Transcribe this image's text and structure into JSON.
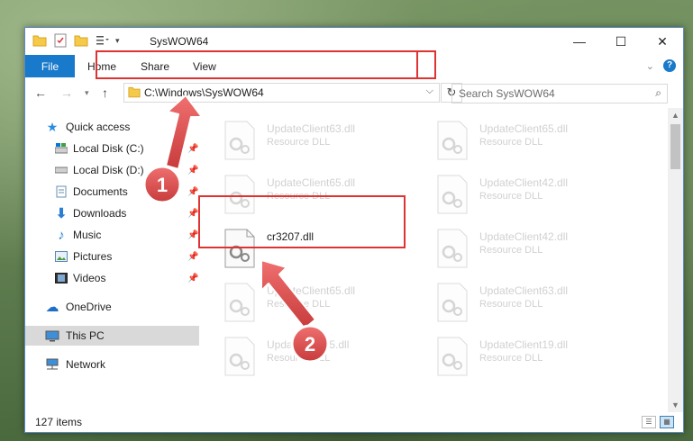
{
  "window": {
    "title": "SysWOW64"
  },
  "ribbon": {
    "tabs": [
      "File",
      "Home",
      "Share",
      "View"
    ]
  },
  "nav": {
    "address": "C:\\Windows\\SysWOW64",
    "search_placeholder": "Search SysWOW64"
  },
  "sidebar": {
    "items": [
      {
        "label": "Quick access",
        "icon": "star-icon"
      },
      {
        "label": "Local Disk (C:)",
        "icon": "drive-icon",
        "pinned": true
      },
      {
        "label": "Local Disk (D:)",
        "icon": "drive-icon",
        "pinned": true
      },
      {
        "label": "Documents",
        "icon": "documents-icon",
        "pinned": true
      },
      {
        "label": "Downloads",
        "icon": "download-icon",
        "pinned": true
      },
      {
        "label": "Music",
        "icon": "music-icon",
        "pinned": true
      },
      {
        "label": "Pictures",
        "icon": "pictures-icon",
        "pinned": true
      },
      {
        "label": "Videos",
        "icon": "videos-icon",
        "pinned": true
      },
      {
        "label": "OneDrive",
        "icon": "cloud-icon"
      },
      {
        "label": "This PC",
        "icon": "computer-icon",
        "selected": true
      },
      {
        "label": "Network",
        "icon": "network-icon"
      }
    ]
  },
  "files": [
    {
      "name": "UpdateClient63.dll",
      "desc": "Resource DLL",
      "faded": true
    },
    {
      "name": "UpdateClient65.dll",
      "desc": "Resource DLL",
      "faded": true
    },
    {
      "name": "UpdateClient65.dll",
      "desc": "Resource DLL",
      "faded": true
    },
    {
      "name": "UpdateClient42.dll",
      "desc": "Resource DLL",
      "faded": true
    },
    {
      "name": "cr3207.dll",
      "desc": "",
      "faded": false
    },
    {
      "name": "UpdateClient42.dll",
      "desc": "Resource DLL",
      "faded": true
    },
    {
      "name": "UpdateClient65.dll",
      "desc": "Resource DLL",
      "faded": true
    },
    {
      "name": "UpdateClient63.dll",
      "desc": "Resource DLL",
      "faded": true
    },
    {
      "name": "UpdateClient5.dll",
      "desc": "Resource DLL",
      "faded": true
    },
    {
      "name": "UpdateClient19.dll",
      "desc": "Resource DLL",
      "faded": true
    }
  ],
  "status": {
    "item_count": "127 items"
  },
  "callouts": {
    "step1": "1",
    "step2": "2",
    "color": "#e05050"
  }
}
